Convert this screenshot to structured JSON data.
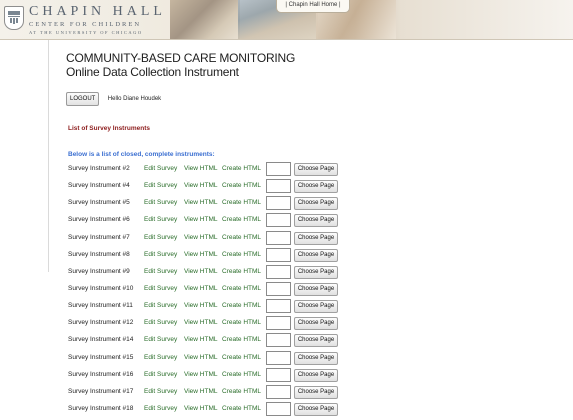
{
  "header": {
    "org_name": "CHAPIN HALL",
    "org_subtitle": "CENTER FOR CHILDREN",
    "org_affiliation": "AT THE UNIVERSITY OF CHICAGO",
    "home_link": "| Chapin Hall Home |"
  },
  "page": {
    "title": "COMMUNITY-BASED CARE MONITORING",
    "subtitle": "Online Data Collection Instrument"
  },
  "user": {
    "logout_label": "LOGOUT",
    "greeting": "Hello Diane Houdek"
  },
  "list": {
    "heading": "List of Survey Instruments",
    "closed_note": "Below is a list of closed, complete instruments:",
    "edit_label": "Edit Survey",
    "view_label": "View HTML",
    "create_label": "Create HTML",
    "choose_label": "Choose Page",
    "items": [
      {
        "name": "Survey Instrument #2"
      },
      {
        "name": "Survey Instrument #4"
      },
      {
        "name": "Survey Instrument #5"
      },
      {
        "name": "Survey Instrument #6"
      },
      {
        "name": "Survey Instrument #7"
      },
      {
        "name": "Survey Instrument #8"
      },
      {
        "name": "Survey Instrument #9"
      },
      {
        "name": "Survey Instrument #10"
      },
      {
        "name": "Survey Instrument #11"
      },
      {
        "name": "Survey Instrument #12"
      },
      {
        "name": "Survey Instrument #14"
      },
      {
        "name": "Survey Instrument #15"
      },
      {
        "name": "Survey Instrument #16"
      },
      {
        "name": "Survey Instrument #17"
      },
      {
        "name": "Survey Instrument #18"
      }
    ]
  },
  "colors": {
    "section_heading": "#8c1b1b",
    "note": "#3b6fd1",
    "links": "#2a6d2a",
    "logo_text": "#5a6470"
  }
}
